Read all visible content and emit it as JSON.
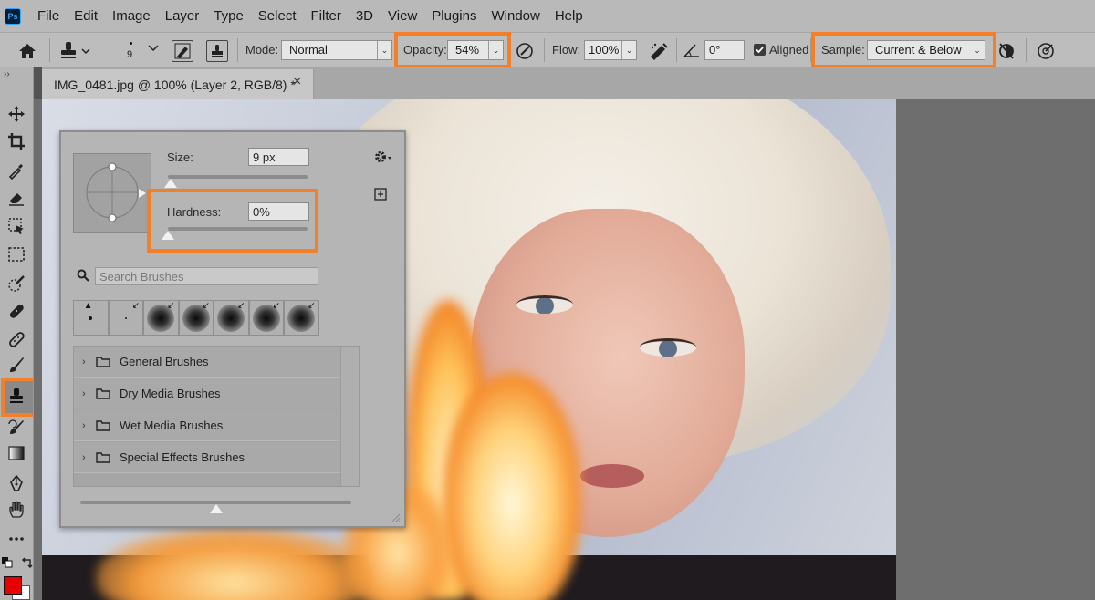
{
  "menubar": {
    "logo": "Ps",
    "items": [
      "File",
      "Edit",
      "Image",
      "Layer",
      "Type",
      "Select",
      "Filter",
      "3D",
      "View",
      "Plugins",
      "Window",
      "Help"
    ]
  },
  "options": {
    "brush_size": "9",
    "mode_label": "Mode:",
    "mode_value": "Normal",
    "opacity_label": "Opacity:",
    "opacity_value": "54%",
    "flow_label": "Flow:",
    "flow_value": "100%",
    "angle_value": "0°",
    "aligned_label": "Aligned",
    "aligned_checked": true,
    "sample_label": "Sample:",
    "sample_value": "Current & Below"
  },
  "document_tab": {
    "title": "IMG_0481.jpg @ 100% (Layer 2, RGB/8) *",
    "close": "×"
  },
  "toolbar": {
    "collapse": "››",
    "active_tool": "clone-stamp",
    "foreground_color": "#e60000",
    "background_color": "#ffffff"
  },
  "brush_panel": {
    "size_label": "Size:",
    "size_value": "9 px",
    "size_fraction": 0.02,
    "hardness_label": "Hardness:",
    "hardness_value": "0%",
    "hardness_fraction": 0.0,
    "search_placeholder": "Search Brushes",
    "folders": [
      "General Brushes",
      "Dry Media Brushes",
      "Wet Media Brushes",
      "Special Effects Brushes"
    ],
    "preview_fraction": 0.5
  },
  "colors": {
    "highlight": "#f47f2a"
  }
}
